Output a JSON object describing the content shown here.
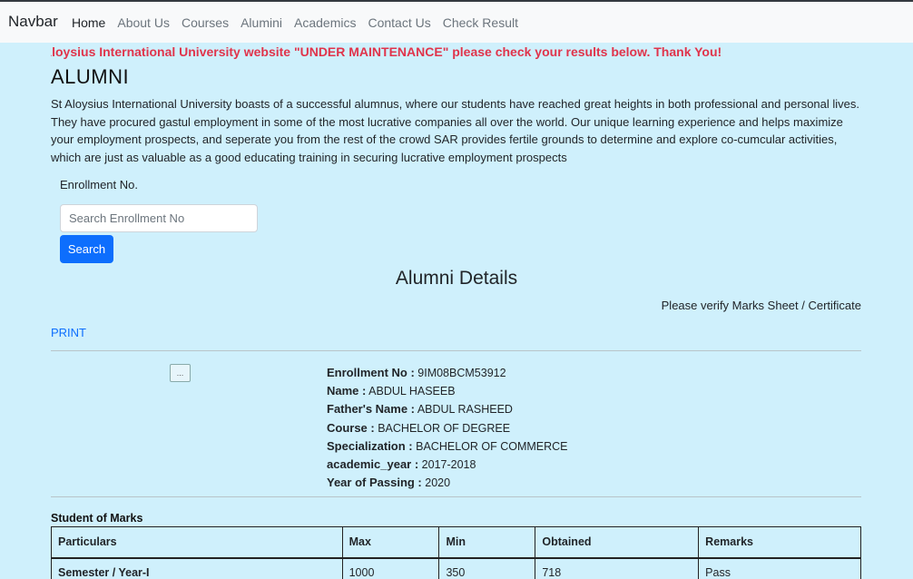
{
  "navbar": {
    "brand": "Navbar",
    "links": [
      "Home",
      "About Us",
      "Courses",
      "Alumini",
      "Academics",
      "Contact Us",
      "Check Result"
    ]
  },
  "marquee": "Aloysius International University website \"UNDER MAINTENANCE\" please check your results below. Thank You!",
  "page_title": "ALUMNI",
  "intro": "St Aloysius International University boasts of a successful alumnus, where our students have reached great heights in both professional and personal lives. They have procured gastul employment in some of the most lucrative companies all over the world. Our unique learning experience and helps maximize your employment prospects, and seperate you from the rest of the crowd SAR provides fertile grounds to determine and explore co-cumcular activities, which are just as valuable as a good educating training in securing lucrative employment prospects",
  "search": {
    "label": "Enrollment No.",
    "placeholder": "Search Enrollment No",
    "button": "Search"
  },
  "details_title": "Alumni Details",
  "verify_text": "Please verify Marks Sheet / Certificate",
  "print_label": "PRINT",
  "photo_alt": "...",
  "student": {
    "enrollment_label": "Enrollment No :",
    "enrollment": "9IM08BCM53912",
    "name_label": "Name :",
    "name": "ABDUL HASEEB",
    "father_label": "Father's Name :",
    "father": "ABDUL RASHEED",
    "course_label": "Course :",
    "course": "BACHELOR OF DEGREE",
    "spec_label": "Specialization :",
    "spec": "BACHELOR OF COMMERCE",
    "year_label": "academic_year :",
    "year": "2017-2018",
    "passing_label": "Year of Passing :",
    "passing": "2020"
  },
  "marks": {
    "caption": "Student of Marks",
    "headers": [
      "Particulars",
      "Max",
      "Min",
      "Obtained",
      "Remarks"
    ],
    "rows": [
      [
        "Semester / Year-I",
        "1000",
        "350",
        "718",
        "Pass"
      ]
    ]
  }
}
